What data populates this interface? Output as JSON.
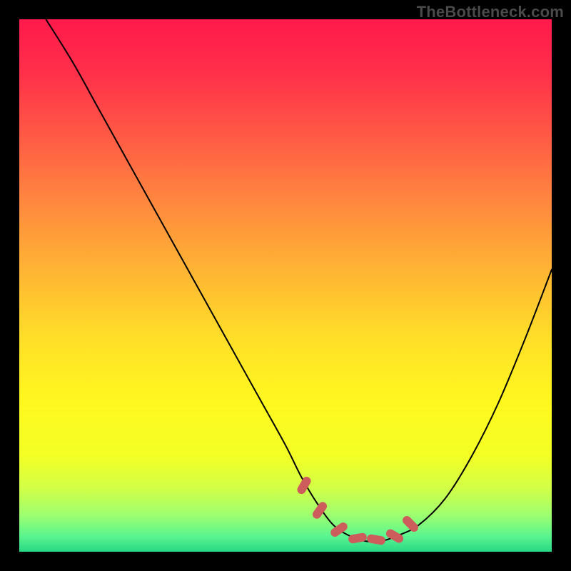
{
  "watermark": "TheBottleneck.com",
  "layout": {
    "canvas_size": 800,
    "plot_margin": 27,
    "plot_size": 746
  },
  "colors": {
    "background": "#000000",
    "watermark": "#4a4a4a",
    "curve": "#000000",
    "marker_fill": "#cd5c5c",
    "gradient_stops": [
      {
        "offset": 0.0,
        "color": "#ff1a4b"
      },
      {
        "offset": 0.1,
        "color": "#ff2f4a"
      },
      {
        "offset": 0.22,
        "color": "#ff5a45"
      },
      {
        "offset": 0.35,
        "color": "#ff8a3e"
      },
      {
        "offset": 0.48,
        "color": "#ffb733"
      },
      {
        "offset": 0.6,
        "color": "#ffdf28"
      },
      {
        "offset": 0.72,
        "color": "#fff81f"
      },
      {
        "offset": 0.82,
        "color": "#f3ff25"
      },
      {
        "offset": 0.88,
        "color": "#d2ff46"
      },
      {
        "offset": 0.93,
        "color": "#9fff6e"
      },
      {
        "offset": 0.97,
        "color": "#5cf58f"
      },
      {
        "offset": 1.0,
        "color": "#27d884"
      }
    ]
  },
  "chart_data": {
    "type": "line",
    "title": "",
    "xlabel": "",
    "ylabel": "",
    "xlim": [
      0,
      100
    ],
    "ylim": [
      0,
      100
    ],
    "grid": false,
    "series": [
      {
        "name": "bottleneck-curve",
        "x": [
          5,
          10,
          15,
          20,
          25,
          30,
          35,
          40,
          45,
          50,
          53,
          56,
          59,
          62,
          65,
          68,
          71,
          75,
          80,
          85,
          90,
          95,
          100
        ],
        "y": [
          100,
          92,
          83,
          74,
          65,
          56,
          47,
          38,
          29,
          20,
          14,
          9,
          5,
          3,
          2,
          2,
          3,
          5,
          10,
          18,
          28,
          40,
          53
        ]
      }
    ],
    "markers": {
      "name": "highlight-points",
      "shape": "rounded-rect",
      "x": [
        53.5,
        56.5,
        60.0,
        63.5,
        67.0,
        70.5,
        73.5
      ],
      "y": [
        12.5,
        7.8,
        4.2,
        2.6,
        2.3,
        3.0,
        5.2
      ],
      "rotation_deg": [
        -60,
        -55,
        -35,
        -10,
        10,
        30,
        45
      ]
    }
  }
}
